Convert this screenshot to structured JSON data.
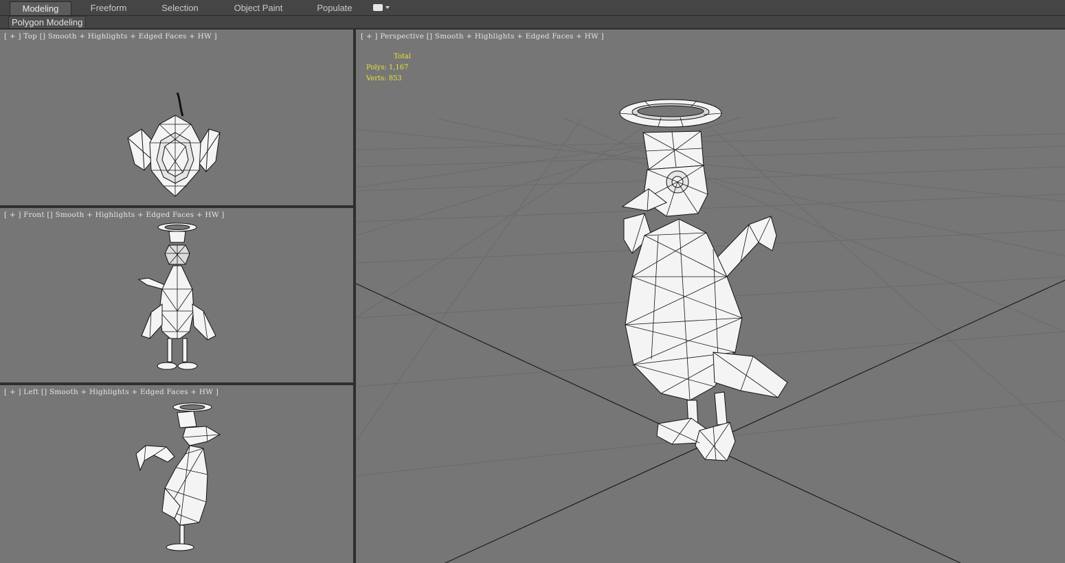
{
  "ribbon": {
    "tabs": [
      {
        "label": "Modeling",
        "active": true
      },
      {
        "label": "Freeform",
        "active": false
      },
      {
        "label": "Selection",
        "active": false
      },
      {
        "label": "Object Paint",
        "active": false
      },
      {
        "label": "Populate",
        "active": false
      }
    ],
    "dropdown_icon": "panel-options-icon"
  },
  "subribbon": {
    "panel_label": "Polygon Modeling"
  },
  "viewports": {
    "top": {
      "label": "[ + ] Top [] Smooth + Highlights + Edged Faces + HW ]"
    },
    "front": {
      "label": "[ + ] Front [] Smooth + Highlights + Edged Faces + HW ]"
    },
    "left": {
      "label": "[ + ] Left [] Smooth + Highlights + Edged Faces + HW ]"
    },
    "perspective": {
      "label": "[ + ] Perspective [] Smooth + Highlights + Edged Faces + HW ]",
      "stats": {
        "title": "Total",
        "polys": "Polys: 1,167",
        "verts": "Verts: 853"
      }
    }
  },
  "colors": {
    "viewport_bg": "#767676",
    "stats_text": "#e8e33a",
    "grid_line": "#6a6a6a",
    "axis_line": "#1c1c1c",
    "mesh_fill": "#f4f4f4",
    "mesh_wire": "#111111"
  }
}
